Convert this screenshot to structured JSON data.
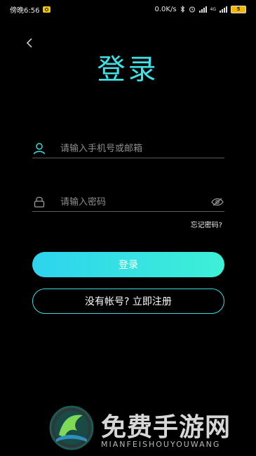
{
  "status_bar": {
    "time": "傍晚6:56",
    "network_speed": "0.0K/s",
    "network_type": "4G",
    "battery": "5"
  },
  "header": {
    "back_icon": "chevron-left-icon",
    "title": "登录"
  },
  "form": {
    "account_placeholder": "请输入手机号或邮箱",
    "account_value": "",
    "password_placeholder": "请输入密码",
    "password_value": "",
    "forgot_label": "忘记密码?"
  },
  "actions": {
    "login_label": "登录",
    "register_label": "没有帐号? 立即注册"
  },
  "watermark": {
    "title": "免费手游网",
    "subtitle": "MIANFEISHOUYOUWANG"
  },
  "colors": {
    "accent": "#3de3e6",
    "background": "#000000",
    "button_gradient_start": "#2dd4ee",
    "button_gradient_end": "#3ef0d6"
  }
}
